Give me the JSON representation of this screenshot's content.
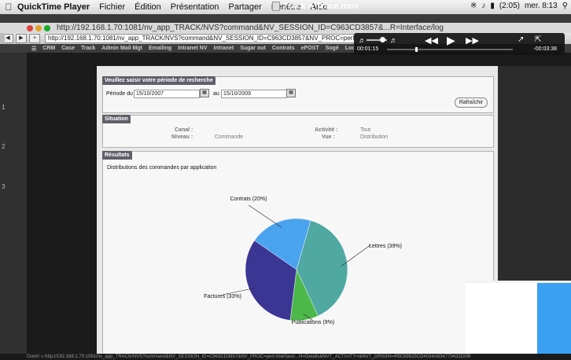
{
  "menubar": {
    "app_name": "QuickTime Player",
    "items": [
      "Fichier",
      "Édition",
      "Présentation",
      "Partager",
      "Fenêtre",
      "Aide"
    ],
    "clock": "mer. 8:13",
    "battery": "(2:05)",
    "doc_title": "Track n Trace.mov"
  },
  "browser": {
    "title_url": "http://192.168.1.70:1081/nv_app_TRACK/NVS?command&NV_SESSION_ID=C963CD3857&...R=Interface/log",
    "address": "http://192.168.1.70:1081/nv_app_TRACK/NVS?command&NV_SESSION_ID=C963CD3857&NV_PROC=perl:inte",
    "nav_items": [
      "CRM",
      "Case",
      "Track",
      "Admin Mail Mgt",
      "Emailing",
      "Intranet NV",
      "Intranet",
      "Sugar out",
      "Contrats",
      "ePOST",
      "Sogé",
      "Loc"
    ]
  },
  "sidebar": {
    "numbers": [
      "1",
      "2",
      "3"
    ]
  },
  "qt_controls": {
    "time_elapsed": "00:01:15",
    "time_remaining": "-00:03:38"
  },
  "search": {
    "heading": "Veuillez saisir votre période de recherche",
    "period_label": "Période du",
    "date_from": "15/10/2007",
    "to_label": "au",
    "date_to": "15/10/2009",
    "refresh_label": "Rafraîchir"
  },
  "situation": {
    "heading": "Situation",
    "canal_label": "Canal :",
    "niveau_label": "Niveau :",
    "niveau_value": "Commande",
    "activite_label": "Activité :",
    "activite_value": "Tout",
    "vue_label": "Vue :",
    "vue_value": "Distribution"
  },
  "results": {
    "heading": "Résultats",
    "description": "Distributions des commandes par application"
  },
  "chart_data": {
    "type": "pie",
    "categories": [
      "Lettres",
      "Publications",
      "Factures",
      "Contrats"
    ],
    "values": [
      39,
      9,
      33,
      20
    ],
    "labels": [
      "Lettres (39%)",
      "Publications (9%)",
      "Factures (33%)",
      "Contrats (20%)"
    ],
    "colors": [
      "#4fa9a2",
      "#4cb84a",
      "#3b3594",
      "#4aa3ee"
    ]
  },
  "statusbar": {
    "text": "Ouvrir « http://192.168.1.70:1081/nv_app_TRACK/NVS?command&NV_SESSION_ID=C963CD3857&NV_PROC=perl:interface/...N=Details&NVT_ACTIVITY=&NVT_ORIGIN=4f9C99825CD4034A834779432D0f8"
  }
}
